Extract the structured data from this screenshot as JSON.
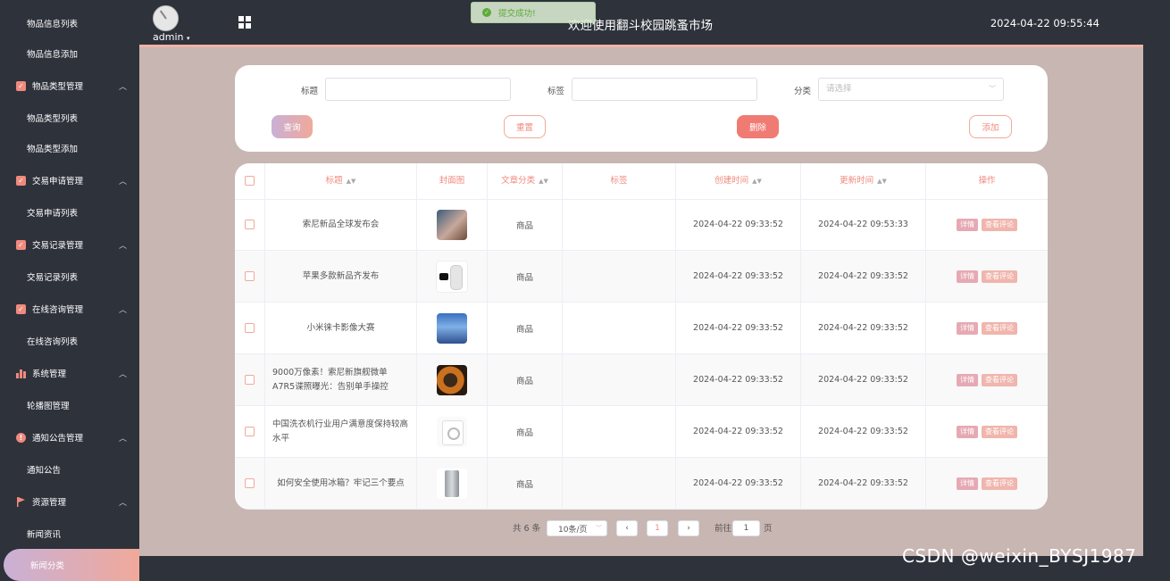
{
  "header": {
    "user": "admin",
    "title": "欢迎使用翻斗校园跳蚤市场",
    "datetime": "2024-04-22 09:55:44",
    "toast": "提交成功!"
  },
  "sidebar": {
    "items": [
      {
        "label": "物品信息列表"
      },
      {
        "label": "物品信息添加"
      },
      {
        "label": "物品类型管理"
      },
      {
        "label": "物品类型列表"
      },
      {
        "label": "物品类型添加"
      },
      {
        "label": "交易申请管理"
      },
      {
        "label": "交易申请列表"
      },
      {
        "label": "交易记录管理"
      },
      {
        "label": "交易记录列表"
      },
      {
        "label": "在线咨询管理"
      },
      {
        "label": "在线咨询列表"
      },
      {
        "label": "系统管理"
      },
      {
        "label": "轮播图管理"
      },
      {
        "label": "通知公告管理"
      },
      {
        "label": "通知公告"
      },
      {
        "label": "资源管理"
      },
      {
        "label": "新闻资讯"
      },
      {
        "label": "新闻分类"
      }
    ]
  },
  "search": {
    "title_label": "标题",
    "tag_label": "标签",
    "category_label": "分类",
    "category_placeholder": "请选择",
    "query": "查询",
    "reset": "重置",
    "delete": "删除",
    "add": "添加"
  },
  "table": {
    "headers": [
      "标题",
      "封面图",
      "文章分类",
      "标签",
      "创建时间",
      "更新时间",
      "操作"
    ],
    "rows": [
      {
        "title": "索尼新品全球发布会",
        "category": "商品",
        "tag": "",
        "created": "2024-04-22 09:33:52",
        "updated": "2024-04-22 09:53:33"
      },
      {
        "title": "苹果多款新品齐发布",
        "category": "商品",
        "tag": "",
        "created": "2024-04-22 09:33:52",
        "updated": "2024-04-22 09:33:52"
      },
      {
        "title": "小米徕卡影像大赛",
        "category": "商品",
        "tag": "",
        "created": "2024-04-22 09:33:52",
        "updated": "2024-04-22 09:33:52"
      },
      {
        "title": "9000万像素！索尼新旗舰微单A7R5谍照曝光：告别单手操控",
        "category": "商品",
        "tag": "",
        "created": "2024-04-22 09:33:52",
        "updated": "2024-04-22 09:33:52"
      },
      {
        "title": "中国洗衣机行业用户满意度保持较高水平",
        "category": "商品",
        "tag": "",
        "created": "2024-04-22 09:33:52",
        "updated": "2024-04-22 09:33:52"
      },
      {
        "title": "如何安全使用冰箱？牢记三个要点",
        "category": "商品",
        "tag": "",
        "created": "2024-04-22 09:33:52",
        "updated": "2024-04-22 09:33:52"
      }
    ],
    "detail_label": "详情",
    "comments_label": "查看评论"
  },
  "pagination": {
    "total": "共 6 条",
    "page_size": "10条/页",
    "prev": "‹",
    "current": "1",
    "next": "›",
    "goto_label": "前往",
    "goto_value": "1",
    "page_suffix": "页"
  },
  "watermark": "CSDN @weixin_BYSJ1987"
}
